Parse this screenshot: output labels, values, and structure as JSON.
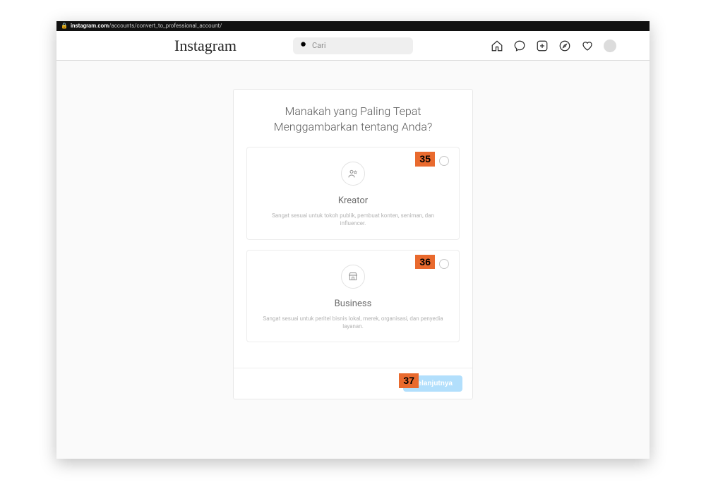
{
  "browser": {
    "domain": "instagram.com",
    "path": "/accounts/convert_to_professional_account/"
  },
  "logo_text": "Instagram",
  "search": {
    "placeholder": "Cari"
  },
  "nav_icons": {
    "home": "home-icon",
    "messenger": "messenger-icon",
    "new_post": "plus-square-icon",
    "explore": "compass-icon",
    "activity": "heart-icon",
    "profile": "avatar"
  },
  "card": {
    "title": "Manakah yang Paling Tepat Menggambarkan tentang Anda?",
    "options": [
      {
        "id": "creator",
        "name": "Kreator",
        "desc": "Sangat sesuai untuk tokoh publik, pembuat konten, seniman, dan influencer."
      },
      {
        "id": "business",
        "name": "Business",
        "desc": "Sangat sesuai untuk peritel bisnis lokal, merek, organisasi, dan penyedia layanan."
      }
    ],
    "next_label": "Selanjutnya"
  },
  "annotations": {
    "a35": "35",
    "a36": "36",
    "a37": "37"
  }
}
